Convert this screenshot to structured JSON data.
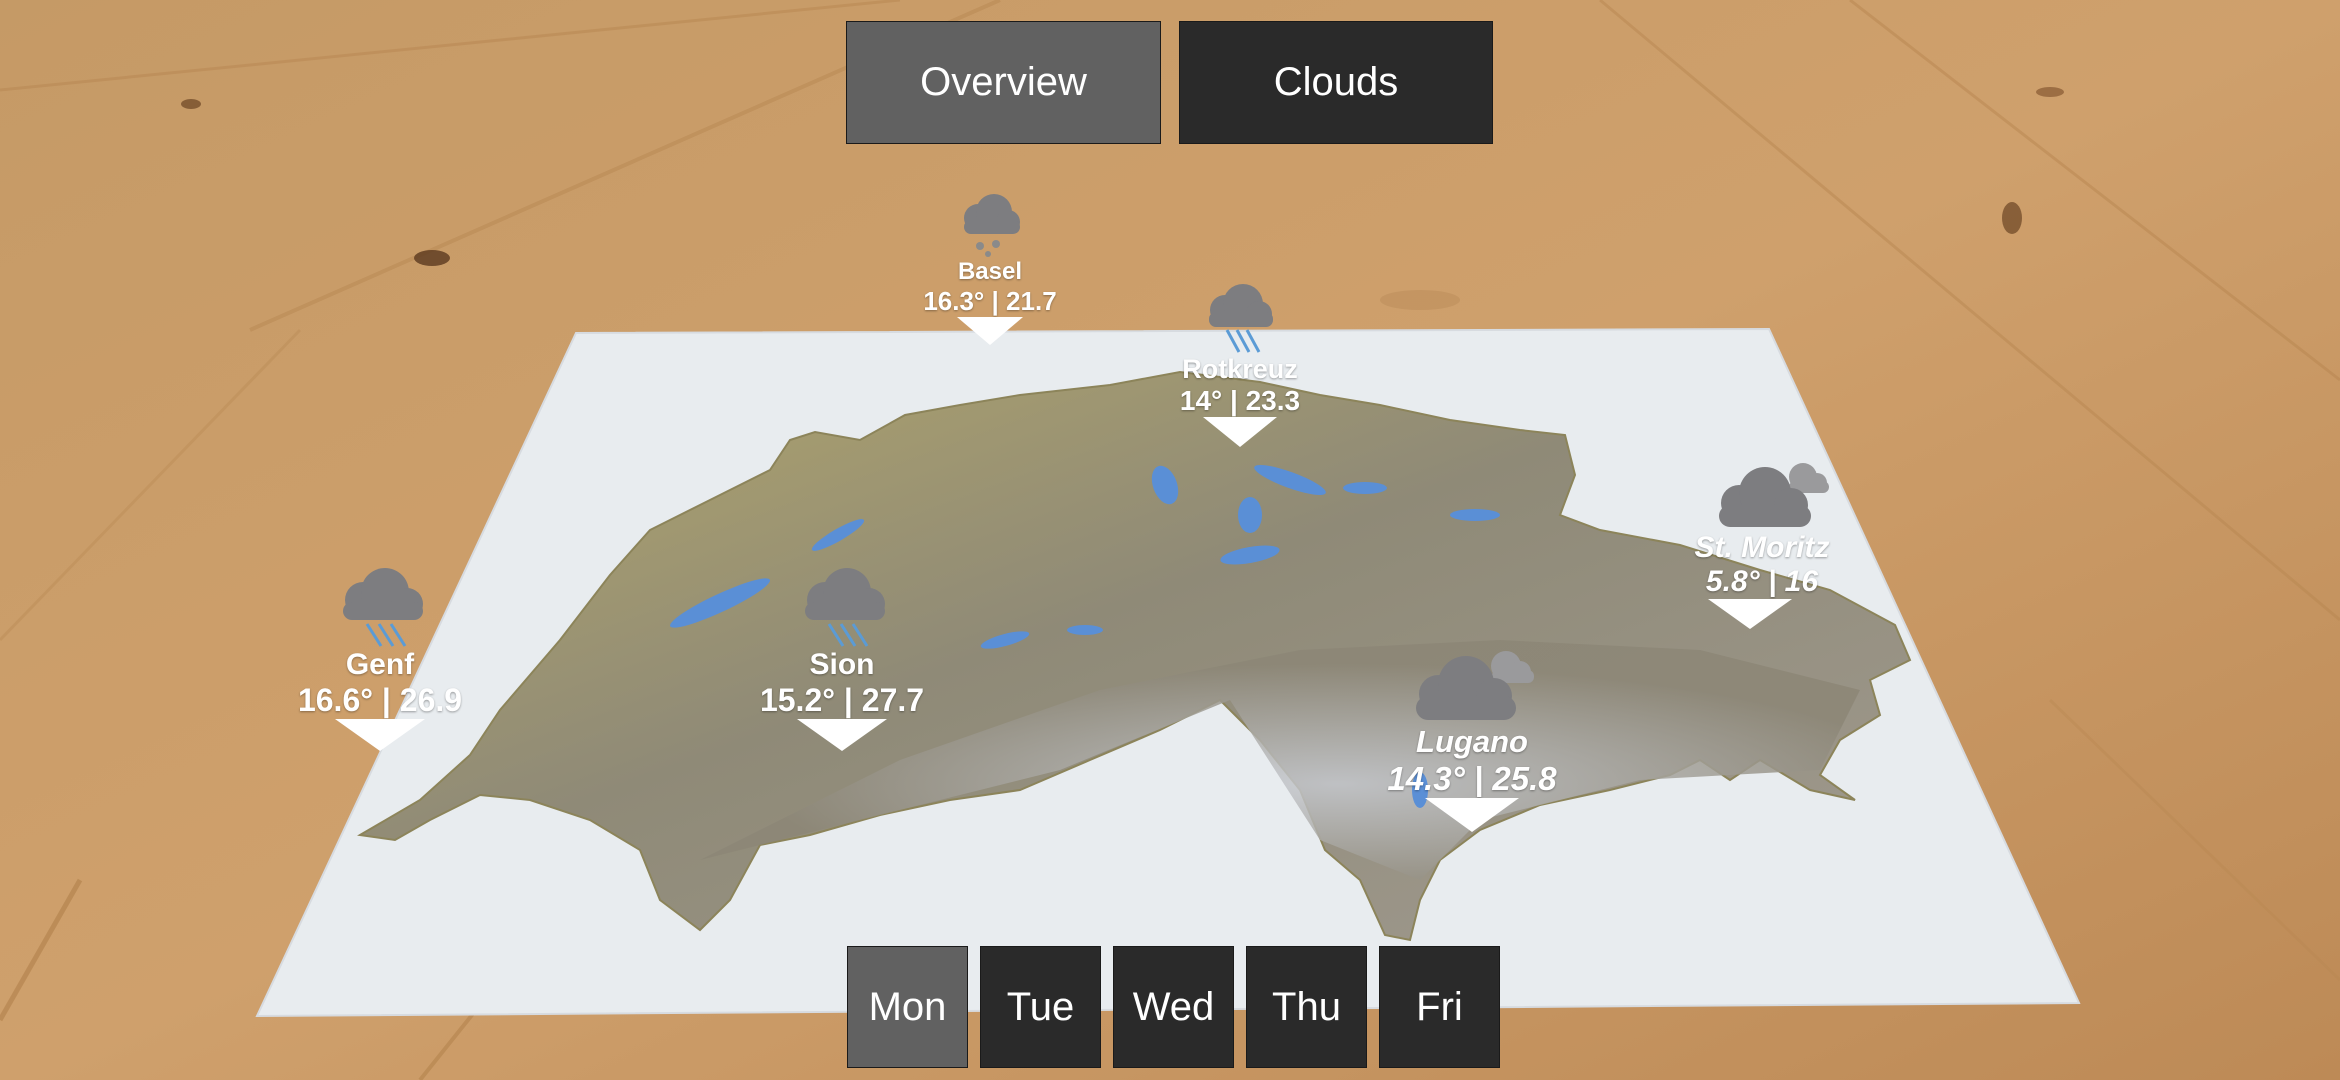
{
  "modes": [
    {
      "label": "Overview",
      "active": false
    },
    {
      "label": "Clouds",
      "active": true
    }
  ],
  "days": [
    {
      "label": "Mon",
      "active": true
    },
    {
      "label": "Tue",
      "active": false
    },
    {
      "label": "Wed",
      "active": false
    },
    {
      "label": "Thu",
      "active": false
    },
    {
      "label": "Fri",
      "active": false
    }
  ],
  "markers": [
    {
      "city": "Basel",
      "temps": "16.3° | 21.7",
      "icon": "rain-cloud-icon"
    },
    {
      "city": "Rotkreuz",
      "temps": "14° | 23.3",
      "icon": "rain-cloud-icon"
    },
    {
      "city": "Genf",
      "temps": "16.6° | 26.9",
      "icon": "rain-cloud-icon"
    },
    {
      "city": "Sion",
      "temps": "15.2° | 27.7",
      "icon": "rain-cloud-icon"
    },
    {
      "city": "St. Moritz",
      "temps": "5.8° | 16",
      "icon": "cloudy-icon"
    },
    {
      "city": "Lugano",
      "temps": "14.3° | 25.8",
      "icon": "cloudy-icon"
    }
  ],
  "colors": {
    "button_active": "#616161",
    "button_inactive": "#2a2a2a",
    "cloud": "#7d7d80",
    "rain": "#5b9bd5",
    "table": "#c9955f",
    "paper": "#e9edf0",
    "lake": "#5a8fd6"
  }
}
